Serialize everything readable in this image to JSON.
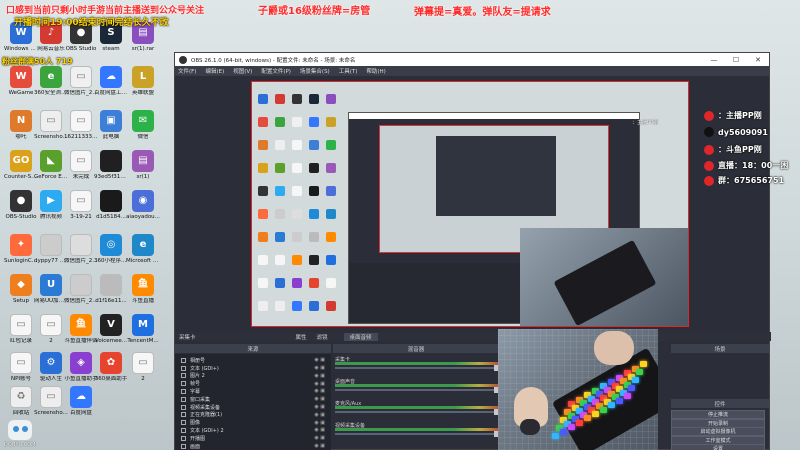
{
  "overlay": {
    "top_left_line1": "口感到当前只剩小时手游当前主播送到公众号关注",
    "top_left_line2": "开播时间19:00结束时间完结长久不改",
    "top_center": "子爵或16级粉丝牌=房管",
    "top_right": "弹幕提=真爱。弹队友=提请求",
    "fan_count_badge": "粉丝群满50人 719"
  },
  "right_panel": {
    "lines": [
      {
        "icon": "weibo-icon",
        "text": "：主播PP刚",
        "color": "#e0262b"
      },
      {
        "icon": "tiktok-icon",
        "text": "dy5609091",
        "color": "#111111"
      },
      {
        "icon": "douyu-icon",
        "text": "：斗鱼PP刚",
        "color": "#e0262b"
      },
      {
        "icon": "clock-icon",
        "text": "直播：18：00一困",
        "color": "#e0262b"
      },
      {
        "icon": "group-icon",
        "text": "群：675656751",
        "color": "#e0262b"
      }
    ]
  },
  "desktop_icons": [
    {
      "label": "Windows 2020【...】",
      "color": "#2b6fd6",
      "glyph": "W"
    },
    {
      "label": "网易云音乐",
      "color": "#d33a31",
      "glyph": "♪"
    },
    {
      "label": "OBS Studio",
      "color": "#333333",
      "glyph": "●"
    },
    {
      "label": "steam",
      "color": "#1b2838",
      "glyph": "S"
    },
    {
      "label": "sr(1).rar",
      "color": "#8a4fbf",
      "glyph": "▤"
    },
    {
      "label": "WeGame",
      "color": "#e64c3c",
      "glyph": "W"
    },
    {
      "label": "360安全浏览器",
      "color": "#3ca43c",
      "glyph": "e"
    },
    {
      "label": "微信图片_2021050...",
      "color": "#f0f0f0",
      "glyph": "▭"
    },
    {
      "label": "百度网盘工作空间",
      "color": "#3377ff",
      "glyph": "☁"
    },
    {
      "label": "英雄联盟",
      "color": "#c9a227",
      "glyph": "L"
    },
    {
      "label": "哪吒",
      "color": "#e07a2b",
      "glyph": "N"
    },
    {
      "label": "Screensho...",
      "color": "#eeeeee",
      "glyph": "▭"
    },
    {
      "label": "162113332...",
      "color": "#f6f6f6",
      "glyph": "▭"
    },
    {
      "label": "此电脑",
      "color": "#3d7fd6",
      "glyph": "▣"
    },
    {
      "label": "微信",
      "color": "#2db24a",
      "glyph": "✉"
    },
    {
      "label": "Counter-Strike Global Off...",
      "color": "#d9a21a",
      "glyph": "GO"
    },
    {
      "label": "GeForce Experience",
      "color": "#5aa02c",
      "glyph": "◣"
    },
    {
      "label": "未完成",
      "color": "#f6f6f6",
      "glyph": "▭"
    },
    {
      "label": "93ed5f31ea...",
      "color": "#202020",
      "glyph": ""
    },
    {
      "label": "sr(1)",
      "color": "#9b59b6",
      "glyph": "▤"
    },
    {
      "label": "OBS-Studio",
      "color": "#333333",
      "glyph": "●"
    },
    {
      "label": "腾讯视频",
      "color": "#2eaaf0",
      "glyph": "▶"
    },
    {
      "label": "3-19-21",
      "color": "#f6f6f6",
      "glyph": "▭"
    },
    {
      "label": "d1d5184...",
      "color": "#1a1a1a",
      "glyph": ""
    },
    {
      "label": "aiaoyadou...",
      "color": "#4b6ed8",
      "glyph": "◉"
    },
    {
      "label": "SunloginCl...",
      "color": "#ff6a3d",
      "glyph": "✦"
    },
    {
      "label": "dyppy77 19微信截...",
      "color": "#cccccc",
      "glyph": ""
    },
    {
      "label": "微信图片_2021062...",
      "color": "#dddddd",
      "glyph": ""
    },
    {
      "label": "360小程序中心",
      "color": "#1f8ad6",
      "glyph": "◎"
    },
    {
      "label": "Microsoft Edge",
      "color": "#1e88c9",
      "glyph": "e"
    },
    {
      "label": "Setup",
      "color": "#ef7e1f",
      "glyph": "◆"
    },
    {
      "label": "网易UU加速器",
      "color": "#2b7bd6",
      "glyph": "U"
    },
    {
      "label": "微信图片_2021062...",
      "color": "#cccccc",
      "glyph": ""
    },
    {
      "label": "d1f16e11...",
      "color": "#bbbbbb",
      "glyph": ""
    },
    {
      "label": "斗鱼直播",
      "color": "#ff8a00",
      "glyph": "鱼"
    },
    {
      "label": "红包记录",
      "color": "#f6f6f6",
      "glyph": "▭"
    },
    {
      "label": "2",
      "color": "#f6f6f6",
      "glyph": "▭"
    },
    {
      "label": "斗鱼直播伴侣",
      "color": "#ff8a00",
      "glyph": "鱼"
    },
    {
      "label": "Voicemee...",
      "color": "#222222",
      "glyph": "V"
    },
    {
      "label": "TencentM...",
      "color": "#1f6fe0",
      "glyph": "M"
    },
    {
      "label": "NPI账号",
      "color": "#f6f6f6",
      "glyph": "▭"
    },
    {
      "label": "驱动人生",
      "color": "#2b6fd6",
      "glyph": "⚙"
    },
    {
      "label": "小鱼直播助手",
      "color": "#8a3fd1",
      "glyph": "◈"
    },
    {
      "label": "360桌面助手",
      "color": "#e6442e",
      "glyph": "✿"
    },
    {
      "label": "2",
      "color": "#f6f6f6",
      "glyph": "▭"
    },
    {
      "label": "回收站",
      "color": "#eeeeee",
      "glyph": "♻"
    },
    {
      "label": "Screensho...",
      "color": "#eeeeee",
      "glyph": "▭"
    },
    {
      "label": "百度网盘",
      "color": "#3377ff",
      "glyph": "☁"
    }
  ],
  "obs": {
    "title": "OBS 26.1.0 (64-bit, windows) - 配置文件: 未命名 - 场景: 未命名",
    "window_controls": [
      "—",
      "☐",
      "✕"
    ],
    "menu": [
      "文件(F)",
      "编辑(E)",
      "视图(V)",
      "配置文件(P)",
      "场景集合(S)",
      "工具(T)",
      "帮助(H)"
    ],
    "source_header": "来源",
    "mixer_header": "混音器",
    "scene_header": "场景",
    "scene_label": "采集卡",
    "toolbar": [
      "属性",
      "滤镜",
      "桌面音频"
    ],
    "sources": [
      "相册号",
      "文本 (GDI+)",
      "图片 2",
      "帧号",
      "字幕",
      "窗口采集",
      "视频采集设备",
      "正在克隆器(1)",
      "图像",
      "文本 (GDI+) 2",
      "开播图",
      "画面"
    ],
    "mixer_tracks": [
      "采集卡",
      "桌面声音",
      "麦克风/Aux",
      "视频采集设备"
    ],
    "controls": [
      "停止推流",
      "开始录制",
      "启动虚拟摄像机",
      "工作室模式",
      "设置",
      "退出"
    ],
    "controls_header": "控件"
  },
  "watermark": {
    "text": "DOUYU.COM"
  }
}
